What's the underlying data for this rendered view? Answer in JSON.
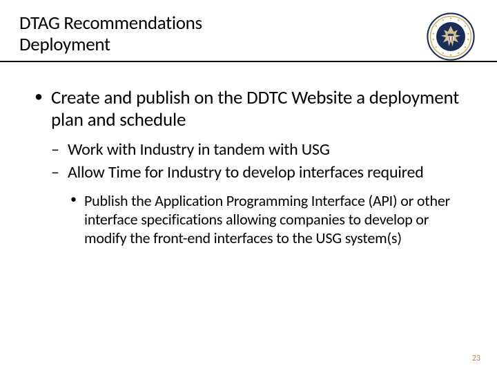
{
  "header": {
    "title_line1": "DTAG Recommendations",
    "title_line2": "Deployment",
    "seal_alt": "us-state-department-seal"
  },
  "content": {
    "lvl1": [
      {
        "text": "Create and publish on the DDTC Website a deployment plan and schedule",
        "lvl2": [
          {
            "text": "Work with Industry in tandem with USG"
          },
          {
            "text": "Allow Time for Industry to develop interfaces required",
            "lvl3": [
              {
                "text": "Publish the Application Programming Interface (API) or other interface specifications allowing companies to develop or modify the front-end interfaces to the USG system(s)"
              }
            ]
          }
        ]
      }
    ]
  },
  "page_number": "23"
}
